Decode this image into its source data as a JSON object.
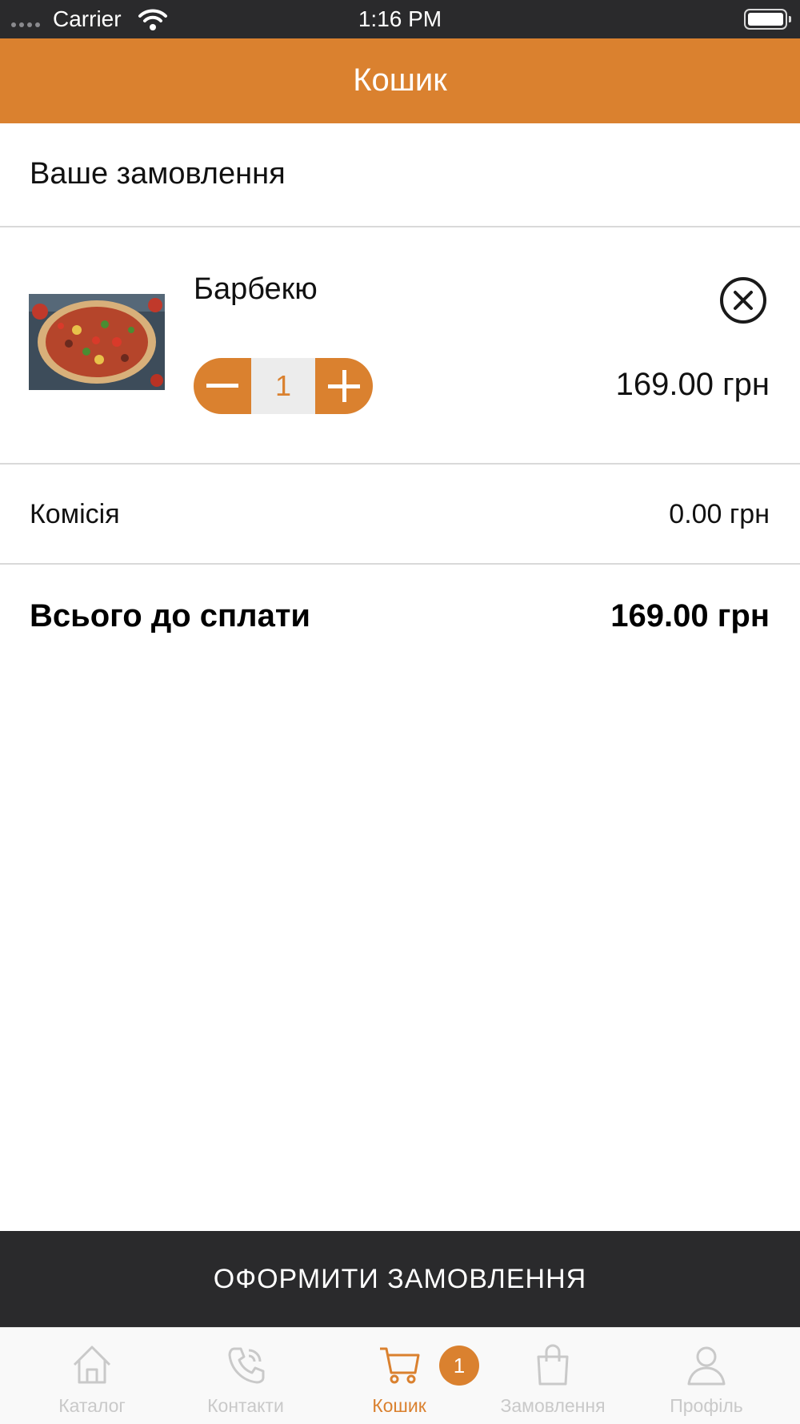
{
  "status_bar": {
    "carrier": "Carrier",
    "time": "1:16 PM"
  },
  "header": {
    "title": "Кошик"
  },
  "cart": {
    "section_title": "Ваше замовлення",
    "items": [
      {
        "name": "Барбекю",
        "quantity": "1",
        "price": "169.00 грн",
        "image": "pizza-photo"
      }
    ],
    "commission_label": "Комісія",
    "commission_value": "0.00 грн",
    "total_label": "Всього до сплати",
    "total_value": "169.00 грн",
    "checkout_label": "ОФОРМИТИ ЗАМОВЛЕННЯ"
  },
  "tab_bar": {
    "tabs": [
      {
        "label": "Каталог",
        "icon": "home-icon"
      },
      {
        "label": "Контакти",
        "icon": "phone-icon"
      },
      {
        "label": "Кошик",
        "icon": "cart-icon",
        "active": true
      },
      {
        "label": "Замовлення",
        "icon": "bag-icon"
      },
      {
        "label": "Профіль",
        "icon": "user-icon"
      }
    ],
    "cart_badge": "1"
  },
  "colors": {
    "accent": "#da812f",
    "dark": "#2a2a2c",
    "inactive": "#c9c9c9"
  }
}
